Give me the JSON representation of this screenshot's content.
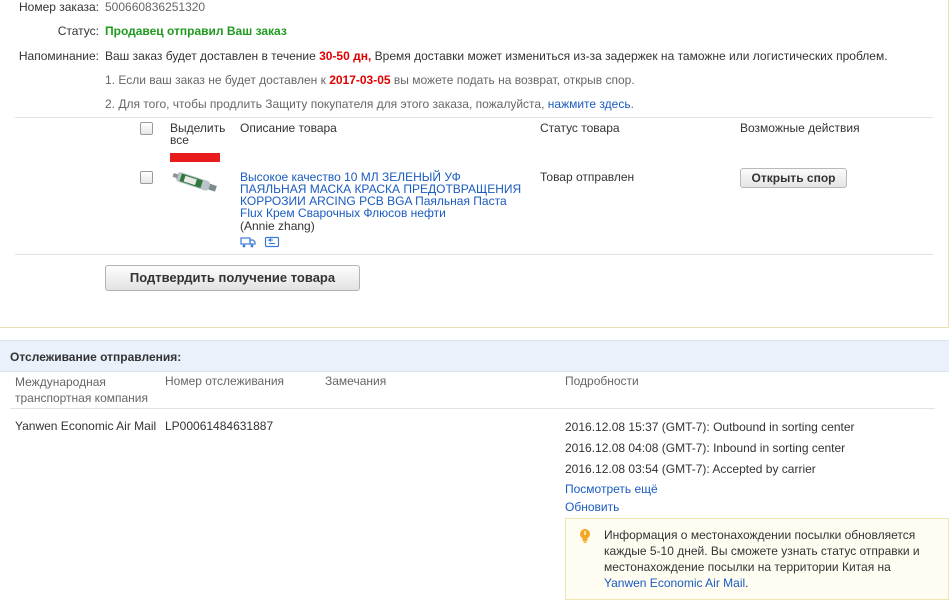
{
  "order": {
    "number_label": "Номер заказа:",
    "number_value": "500660836251320",
    "status_label": "Статус:",
    "status_value": "Продавец отправил Ваш заказ",
    "reminder_label": "Напоминание:",
    "reminder_pre": "Ваш заказ будет доставлен в течение ",
    "reminder_days": "30-50 дн,",
    "reminder_post": " Время доставки может измениться из-за задержек на таможне или логистических проблем.",
    "note1_pre": "1. Если ваш заказ не будет доставлен к ",
    "note1_date": "2017-03-05",
    "note1_post": " вы можете подать на возврат, открыв спор.",
    "note2_pre": "2. Для того, чтобы продлить Защиту покупателя для этого заказа, пожалуйста, ",
    "note2_link": "нажмите здесь",
    "note2_post": "."
  },
  "table": {
    "col_select": "Выделить все",
    "col_description": "Описание товара",
    "col_status": "Статус товара",
    "col_actions": "Возможные действия"
  },
  "item": {
    "title": "Высокое качество 10 МЛ ЗЕЛЕНЫЙ УФ ПАЯЛЬНАЯ МАСКА КРАСКА ПРЕДОТВРАЩЕНИЯ КОРРОЗИИ ARCING PCB BGA Паяльная Паста Flux Крем Сварочных Флюсов нефти",
    "seller": "(Annie zhang)",
    "status": "Товар отправлен",
    "dispute_button": "Открыть спор",
    "icons": [
      "truck-icon",
      "return-icon"
    ]
  },
  "confirm_button": "Подтвердить получение товара",
  "tracking": {
    "title": "Отслеживание отправления:",
    "col_company": "Международная транспортная компания",
    "col_number": "Номер отслеживания",
    "col_remarks": "Замечания",
    "col_details": "Подробности",
    "company": "Yanwen Economic Air Mail",
    "number": "LP00061484631887",
    "events": [
      "2016.12.08 15:37 (GMT-7): Outbound in sorting center",
      "2016.12.08 04:08 (GMT-7): Inbound in sorting center",
      "2016.12.08 03:54 (GMT-7): Accepted by carrier"
    ],
    "more_link": "Посмотреть ещё",
    "refresh_link": "Обновить",
    "info_text": "Информация о местонахождении посылки обновляется каждые 5-10 дней. Вы сможете узнать статус отправки и местонахождение посылки на территории Китая на",
    "info_link": "Yanwen Economic Air Mail",
    "info_end": "."
  },
  "colors": {
    "link": "#1a5bbf",
    "status_green": "#1f9a1f",
    "highlight_red": "#e10000",
    "track_header_bg": "#eaf1fa",
    "info_bg": "#fffdf2"
  }
}
